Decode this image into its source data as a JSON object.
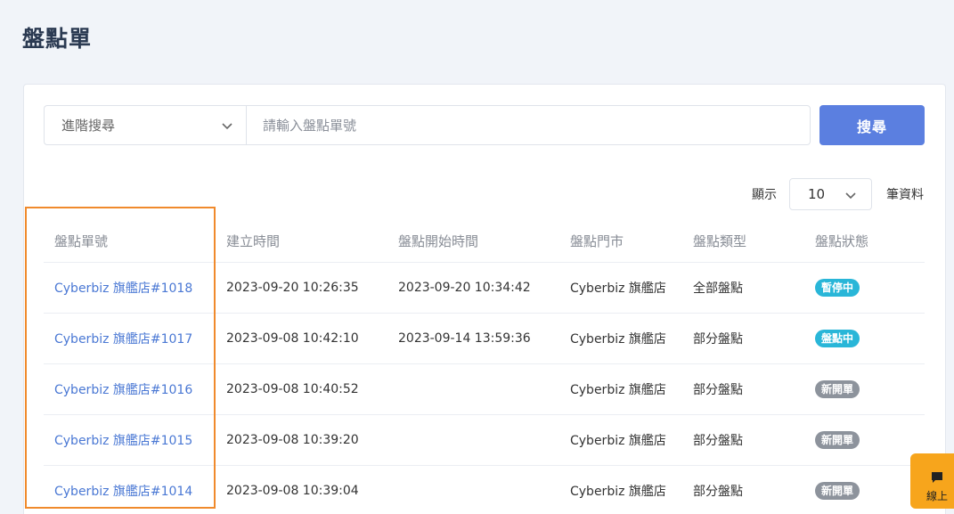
{
  "page": {
    "title": "盤點單"
  },
  "search": {
    "mode_label": "進階搜尋",
    "placeholder": "請輸入盤點單號",
    "button_label": "搜尋"
  },
  "pagination": {
    "prefix": "顯示",
    "page_size": "10",
    "suffix": "筆資料"
  },
  "table": {
    "headers": [
      "盤點單號",
      "建立時間",
      "盤點開始時間",
      "盤點門市",
      "盤點類型",
      "盤點狀態"
    ],
    "rows": [
      {
        "id": "Cyberbiz 旗艦店#1018",
        "created": "2023-09-20 10:26:35",
        "started": "2023-09-20 10:34:42",
        "store": "Cyberbiz 旗艦店",
        "type": "全部盤點",
        "status": "暫停中",
        "status_color": "#29b6d8"
      },
      {
        "id": "Cyberbiz 旗艦店#1017",
        "created": "2023-09-08 10:42:10",
        "started": "2023-09-14 13:59:36",
        "store": "Cyberbiz 旗艦店",
        "type": "部分盤點",
        "status": "盤點中",
        "status_color": "#29b6d8"
      },
      {
        "id": "Cyberbiz 旗艦店#1016",
        "created": "2023-09-08 10:40:52",
        "started": "",
        "store": "Cyberbiz 旗艦店",
        "type": "部分盤點",
        "status": "新開單",
        "status_color": "#8d939c"
      },
      {
        "id": "Cyberbiz 旗艦店#1015",
        "created": "2023-09-08 10:39:20",
        "started": "",
        "store": "Cyberbiz 旗艦店",
        "type": "部分盤點",
        "status": "新開單",
        "status_color": "#8d939c"
      },
      {
        "id": "Cyberbiz 旗艦店#1014",
        "created": "2023-09-08 10:39:04",
        "started": "",
        "store": "Cyberbiz 旗艦店",
        "type": "部分盤點",
        "status": "新開單",
        "status_color": "#8d939c"
      }
    ]
  },
  "chat": {
    "label": "線上",
    "icon": "chat-icon",
    "color": "#f7a51c"
  },
  "highlight": {
    "color": "#f08a2c"
  }
}
